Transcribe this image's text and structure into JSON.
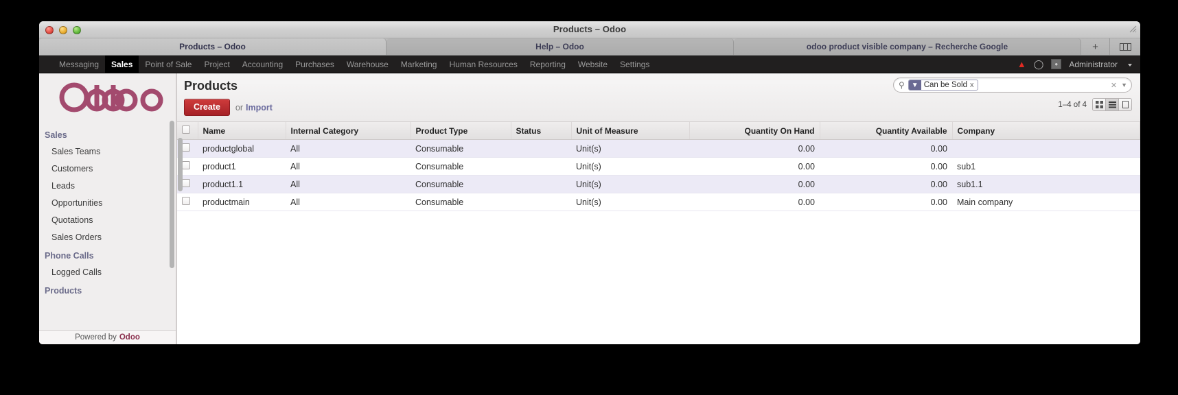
{
  "window": {
    "title": "Products – Odoo",
    "traffic_lights": [
      "close-red",
      "minimize-yellow",
      "zoom-green"
    ]
  },
  "tabs": [
    {
      "label": "Products – Odoo",
      "active": true
    },
    {
      "label": "Help – Odoo",
      "active": false
    },
    {
      "label": "odoo product visible company – Recherche Google",
      "active": false
    }
  ],
  "tabstrip": {
    "new_tab": "+",
    "list_all": "show-all-tabs-icon"
  },
  "navbar": {
    "items": [
      {
        "label": "Messaging",
        "active": false
      },
      {
        "label": "Sales",
        "active": true
      },
      {
        "label": "Point of Sale",
        "active": false
      },
      {
        "label": "Project",
        "active": false
      },
      {
        "label": "Accounting",
        "active": false
      },
      {
        "label": "Purchases",
        "active": false
      },
      {
        "label": "Warehouse",
        "active": false
      },
      {
        "label": "Marketing",
        "active": false
      },
      {
        "label": "Human Resources",
        "active": false
      },
      {
        "label": "Reporting",
        "active": false
      },
      {
        "label": "Website",
        "active": false
      },
      {
        "label": "Settings",
        "active": false
      }
    ],
    "warning_icon": "warning-triangle-icon",
    "chat_icon": "chat-bubble-icon",
    "avatar_icon": "user-avatar",
    "user_name": "Administrator"
  },
  "sidebar": {
    "logo": "odoo-logo",
    "groups": [
      {
        "title": "Sales",
        "links": [
          "Sales Teams",
          "Customers",
          "Leads",
          "Opportunities",
          "Quotations",
          "Sales Orders"
        ]
      },
      {
        "title": "Phone Calls",
        "links": [
          "Logged Calls"
        ]
      },
      {
        "title": "Products",
        "links": []
      }
    ],
    "footer_prefix": "Powered by",
    "footer_brand": "Odoo"
  },
  "main": {
    "page_title": "Products",
    "create_label": "Create",
    "or_label": "or",
    "import_label": "Import",
    "search": {
      "icon": "search-icon",
      "placeholder": "",
      "facets": [
        {
          "icon": "filter-funnel-icon",
          "label": "Can be Sold",
          "remove": "x"
        }
      ],
      "clear_icon": "clear-x-icon",
      "caret_icon": "chevron-down-icon"
    },
    "pager": "1–4 of 4",
    "view_switcher": [
      {
        "name": "kanban-view-button",
        "active": false
      },
      {
        "name": "list-view-button",
        "active": true
      },
      {
        "name": "form-view-button",
        "active": false
      }
    ]
  },
  "table": {
    "columns": [
      {
        "label": "",
        "key": "check",
        "align": "left"
      },
      {
        "label": "Name",
        "key": "name",
        "align": "left"
      },
      {
        "label": "Internal Category",
        "key": "category",
        "align": "left"
      },
      {
        "label": "Product Type",
        "key": "type",
        "align": "left"
      },
      {
        "label": "Status",
        "key": "status",
        "align": "left"
      },
      {
        "label": "Unit of Measure",
        "key": "uom",
        "align": "left"
      },
      {
        "label": "Quantity On Hand",
        "key": "qty_on_hand",
        "align": "right"
      },
      {
        "label": "Quantity Available",
        "key": "qty_available",
        "align": "right"
      },
      {
        "label": "Company",
        "key": "company",
        "align": "left"
      }
    ],
    "rows": [
      {
        "name": "productglobal",
        "category": "All",
        "type": "Consumable",
        "status": "",
        "uom": "Unit(s)",
        "qty_on_hand": "0.00",
        "qty_available": "0.00",
        "company": ""
      },
      {
        "name": "product1",
        "category": "All",
        "type": "Consumable",
        "status": "",
        "uom": "Unit(s)",
        "qty_on_hand": "0.00",
        "qty_available": "0.00",
        "company": "sub1"
      },
      {
        "name": "product1.1",
        "category": "All",
        "type": "Consumable",
        "status": "",
        "uom": "Unit(s)",
        "qty_on_hand": "0.00",
        "qty_available": "0.00",
        "company": "sub1.1"
      },
      {
        "name": "productmain",
        "category": "All",
        "type": "Consumable",
        "status": "",
        "uom": "Unit(s)",
        "qty_on_hand": "0.00",
        "qty_available": "0.00",
        "company": "Main company"
      }
    ]
  },
  "colors": {
    "accent_red": "#a52127",
    "row_stripe": "#eceaf6",
    "navbar_bg": "#211f1f",
    "facet_purple": "#6a6a93",
    "warning_red": "#e02a22",
    "odoo_purple": "#8a2f4d"
  }
}
